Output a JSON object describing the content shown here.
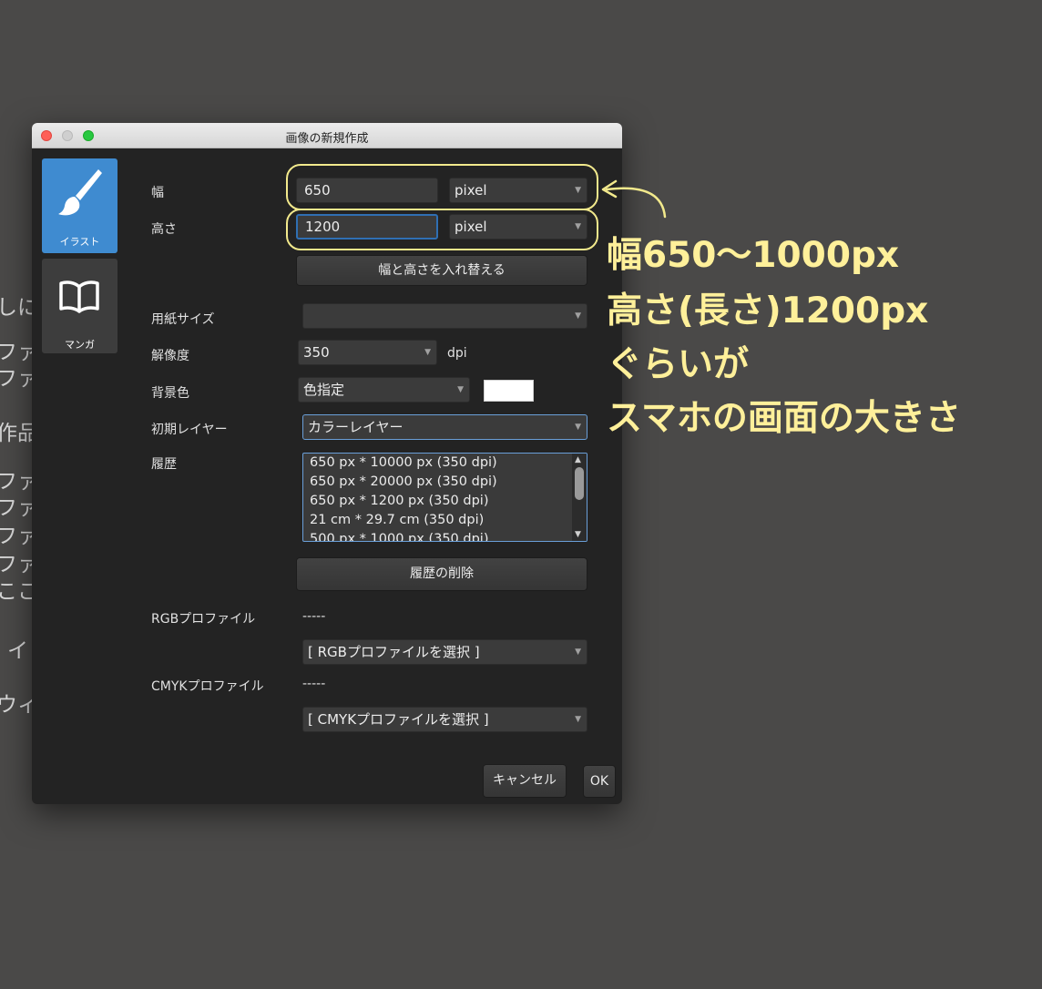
{
  "background": {
    "fragments": [
      "しに",
      "ファ",
      "ファ",
      "作品",
      "ファ",
      "ファ",
      "ファ",
      "ファ",
      "ここ",
      "イ",
      "ウィ"
    ]
  },
  "window": {
    "title": "画像の新規作成"
  },
  "modes": [
    {
      "label": "イラスト",
      "icon": "brush-icon",
      "selected": true
    },
    {
      "label": "マンガ",
      "icon": "open-book-icon",
      "selected": false
    }
  ],
  "form": {
    "width": {
      "label": "幅",
      "value": "650",
      "unit": "pixel"
    },
    "height": {
      "label": "高さ",
      "value": "1200",
      "unit": "pixel"
    },
    "swap_button": "幅と高さを入れ替える",
    "paper_size": {
      "label": "用紙サイズ",
      "value": ""
    },
    "resolution": {
      "label": "解像度",
      "value": "350",
      "unit": "dpi"
    },
    "background": {
      "label": "背景色",
      "value": "色指定",
      "swatch": "#ffffff"
    },
    "initial_layer": {
      "label": "初期レイヤー",
      "value": "カラーレイヤー"
    },
    "history": {
      "label": "履歴",
      "items": [
        "650 px * 10000 px (350 dpi)",
        "650 px * 20000 px (350 dpi)",
        "650 px * 1200 px (350 dpi)",
        "21 cm * 29.7 cm (350 dpi)",
        "500 px * 1000 px (350 dpi)"
      ]
    },
    "delete_history_button": "履歴の削除",
    "rgb": {
      "label": "RGBプロファイル",
      "value": "-----",
      "select": "[ RGBプロファイルを選択 ]"
    },
    "cmyk": {
      "label": "CMYKプロファイル",
      "value": "-----",
      "select": "[ CMYKプロファイルを選択 ]"
    }
  },
  "buttons": {
    "cancel": "キャンセル",
    "ok": "OK"
  },
  "annotation": {
    "lines": [
      "幅650〜1000px",
      "高さ(長さ)1200px",
      "ぐらいが",
      "スマホの画面の大きさ"
    ],
    "color": "#fff09a"
  },
  "colors": {
    "close": "#fe5f57",
    "minimize": "#febc2e",
    "zoom": "#28c840",
    "selected_mode": "#3f8bd0"
  }
}
